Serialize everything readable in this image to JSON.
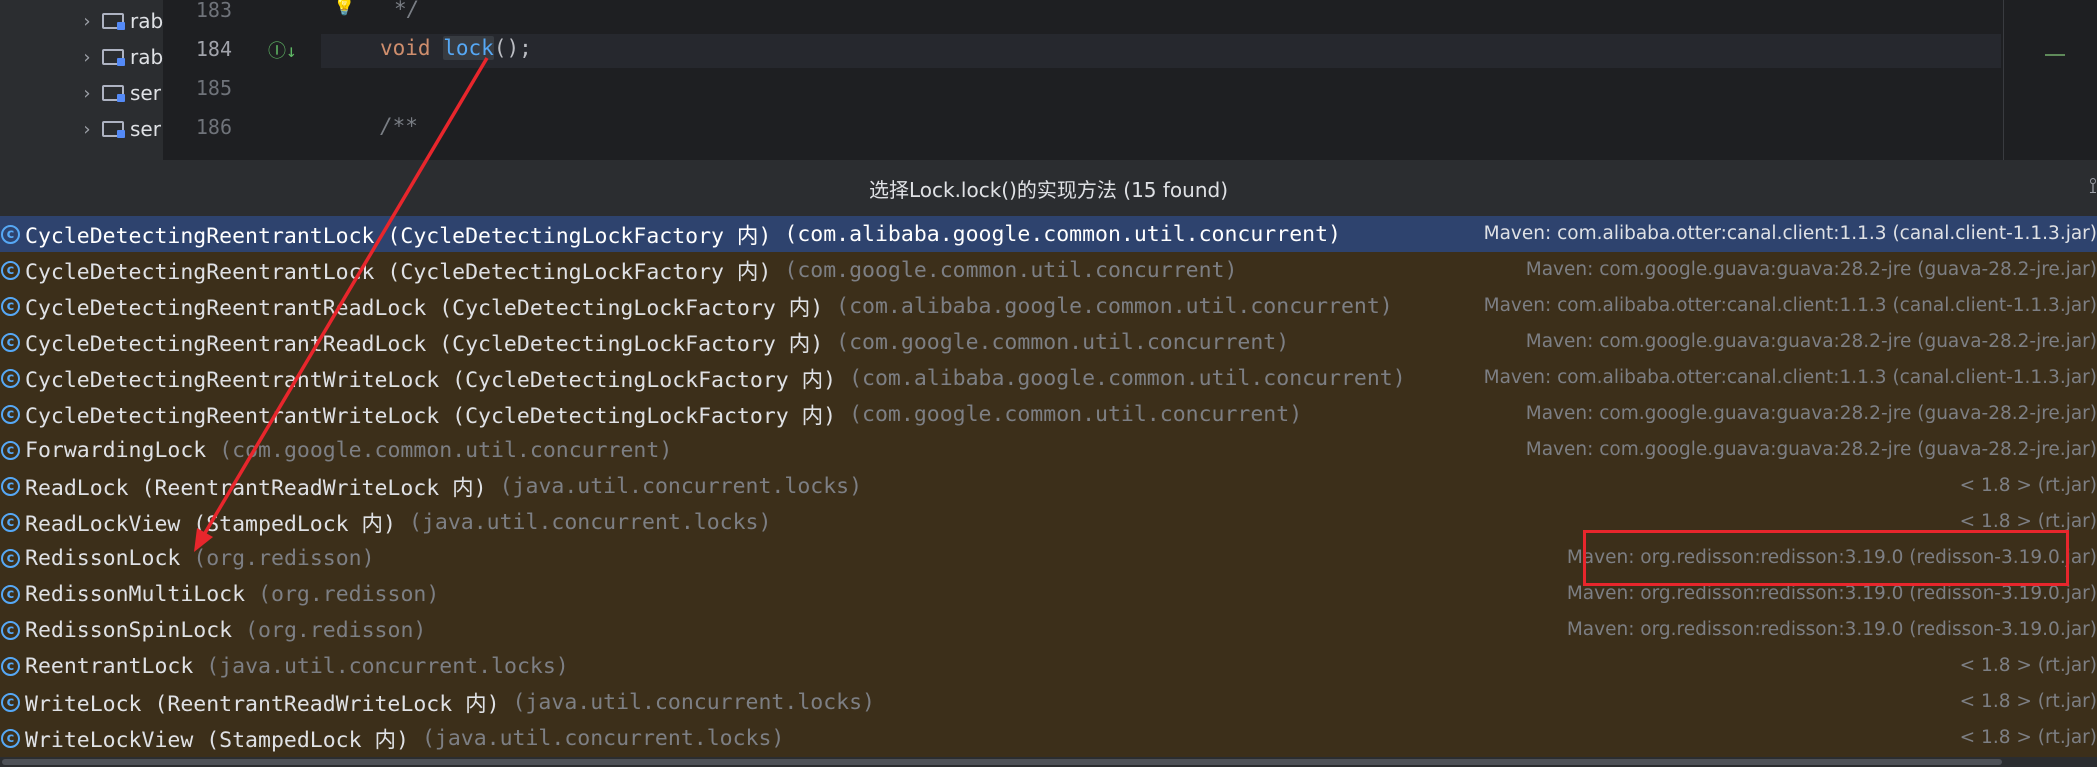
{
  "project_tree": {
    "items": [
      {
        "label": "rab"
      },
      {
        "label": "rab"
      },
      {
        "label": "ser"
      },
      {
        "label": "ser"
      }
    ]
  },
  "editor": {
    "line_numbers": [
      "183",
      "184",
      "185",
      "186"
    ],
    "lines": {
      "l183": "*/",
      "l184_keyword": "void",
      "l184_method": "lock",
      "l184_rest": "();",
      "l186": "/**"
    }
  },
  "popup": {
    "title": "选择Lock.lock()的实现方法 (15 found)",
    "items": [
      {
        "name": "CycleDetectingReentrantLock (CycleDetectingLockFactory 内)",
        "package": "(com.alibaba.google.common.util.concurrent)",
        "library": "Maven: com.alibaba.otter:canal.client:1.1.3 (canal.client-1.1.3.jar)",
        "selected": true
      },
      {
        "name": "CycleDetectingReentrantLock (CycleDetectingLockFactory 内)",
        "package": "(com.google.common.util.concurrent)",
        "library": "Maven: com.google.guava:guava:28.2-jre (guava-28.2-jre.jar)"
      },
      {
        "name": "CycleDetectingReentrantReadLock (CycleDetectingLockFactory 内)",
        "package": "(com.alibaba.google.common.util.concurrent)",
        "library": "Maven: com.alibaba.otter:canal.client:1.1.3 (canal.client-1.1.3.jar)"
      },
      {
        "name": "CycleDetectingReentrantReadLock (CycleDetectingLockFactory 内)",
        "package": "(com.google.common.util.concurrent)",
        "library": "Maven: com.google.guava:guava:28.2-jre (guava-28.2-jre.jar)"
      },
      {
        "name": "CycleDetectingReentrantWriteLock (CycleDetectingLockFactory 内)",
        "package": "(com.alibaba.google.common.util.concurrent)",
        "library": "Maven: com.alibaba.otter:canal.client:1.1.3 (canal.client-1.1.3.jar)"
      },
      {
        "name": "CycleDetectingReentrantWriteLock (CycleDetectingLockFactory 内)",
        "package": "(com.google.common.util.concurrent)",
        "library": "Maven: com.google.guava:guava:28.2-jre (guava-28.2-jre.jar)"
      },
      {
        "name": "ForwardingLock",
        "package": "(com.google.common.util.concurrent)",
        "library": "Maven: com.google.guava:guava:28.2-jre (guava-28.2-jre.jar)"
      },
      {
        "name": "ReadLock (ReentrantReadWriteLock 内)",
        "package": "(java.util.concurrent.locks)",
        "library": "< 1.8 > (rt.jar)"
      },
      {
        "name": "ReadLockView (StampedLock 内)",
        "package": "(java.util.concurrent.locks)",
        "library": "< 1.8 > (rt.jar)"
      },
      {
        "name": "RedissonLock",
        "package": "(org.redisson)",
        "library": "Maven: org.redisson:redisson:3.19.0 (redisson-3.19.0.jar)"
      },
      {
        "name": "RedissonMultiLock",
        "package": "(org.redisson)",
        "library": "Maven: org.redisson:redisson:3.19.0 (redisson-3.19.0.jar)"
      },
      {
        "name": "RedissonSpinLock",
        "package": "(org.redisson)",
        "library": "Maven: org.redisson:redisson:3.19.0 (redisson-3.19.0.jar)"
      },
      {
        "name": "ReentrantLock",
        "package": "(java.util.concurrent.locks)",
        "library": "< 1.8 > (rt.jar)"
      },
      {
        "name": "WriteLock (ReentrantReadWriteLock 内)",
        "package": "(java.util.concurrent.locks)",
        "library": "< 1.8 > (rt.jar)"
      },
      {
        "name": "WriteLockView (StampedLock 内)",
        "package": "(java.util.concurrent.locks)",
        "library": "< 1.8 > (rt.jar)"
      }
    ]
  },
  "icons": {
    "class_icon": "class-icon",
    "folder_icon": "folder-icon",
    "bulb_icon": "intention-bulb-icon",
    "implemented_icon": "implemented-gutter-icon",
    "pin_icon": "pin-icon"
  },
  "colors": {
    "selection": "#2e436e",
    "popup_background": "#3c2f1a",
    "annotation_red": "#e8262c"
  }
}
